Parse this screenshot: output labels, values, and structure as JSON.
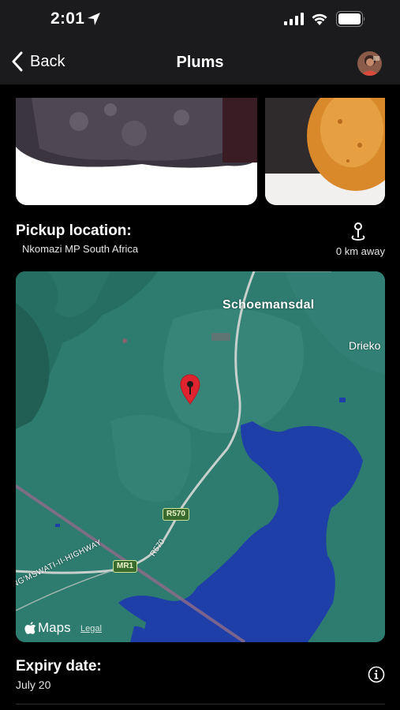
{
  "status_bar": {
    "time": "2:01",
    "icons": [
      "location-arrow-icon",
      "signal-icon",
      "wifi-icon",
      "battery-icon"
    ]
  },
  "nav": {
    "back_label": "Back",
    "title": "Plums",
    "avatar": "user-avatar"
  },
  "photos": [
    {
      "name": "plum-photo"
    },
    {
      "name": "plum-photo"
    }
  ],
  "pickup": {
    "title": "Pickup location:",
    "location": "Nkomazi MP South Africa",
    "distance": "0 km away",
    "icon": "map-pin-icon"
  },
  "map": {
    "place_labels": [
      "Schoemansdal",
      "Drieko"
    ],
    "road_shields": [
      "R570",
      "MR1"
    ],
    "road_labels": [
      "R570",
      "NG'MSWATI-II-HIGHWAY"
    ],
    "brand": "Maps",
    "legal": "Legal",
    "colors": {
      "land": "#2e7b6f",
      "water": "#1f3fa8",
      "pin": "#e0242f"
    }
  },
  "expiry": {
    "title": "Expiry date:",
    "date": "July 20",
    "icon": "info-icon"
  }
}
